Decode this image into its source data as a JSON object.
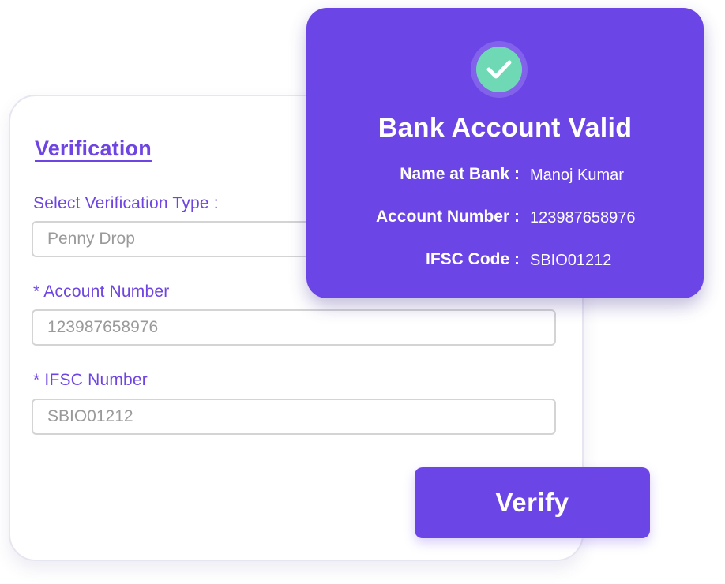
{
  "form": {
    "title": "Verification",
    "verification_type": {
      "label": "Select Verification Type :",
      "value": "Penny Drop"
    },
    "account_number": {
      "label": "* Account Number",
      "placeholder": "123987658976"
    },
    "ifsc_number": {
      "label": "* IFSC Number",
      "placeholder": "SBIO01212"
    },
    "verify_label": "Verify"
  },
  "result": {
    "icon": "check-circle-icon",
    "title": "Bank Account Valid",
    "rows": [
      {
        "label": "Name at Bank :",
        "value": "Manoj Kumar"
      },
      {
        "label": "Account Number :",
        "value": "123987658976"
      },
      {
        "label": "IFSC Code :",
        "value": "SBIO01212"
      }
    ]
  },
  "colors": {
    "accent": "#6b45e6",
    "label_text": "#6e45e2",
    "success": "#6fd9b6",
    "input_border": "#d4d4d4",
    "input_text": "#9a9a9a"
  }
}
